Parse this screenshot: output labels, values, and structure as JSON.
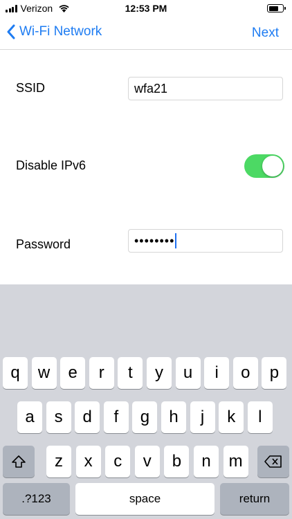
{
  "status_bar": {
    "carrier": "Verizon",
    "time": "12:53 PM",
    "battery_level": 0.7
  },
  "nav": {
    "back_label": "Wi-Fi Network",
    "next_label": "Next"
  },
  "form": {
    "ssid_label": "SSID",
    "ssid_value": "wfa21",
    "ipv6_label": "Disable IPv6",
    "ipv6_enabled": true,
    "password_label": "Password",
    "password_masked": "••••••••"
  },
  "keyboard": {
    "row1": [
      "q",
      "w",
      "e",
      "r",
      "t",
      "y",
      "u",
      "i",
      "o",
      "p"
    ],
    "row2": [
      "a",
      "s",
      "d",
      "f",
      "g",
      "h",
      "j",
      "k",
      "l"
    ],
    "row3": [
      "z",
      "x",
      "c",
      "v",
      "b",
      "n",
      "m"
    ],
    "numbers_label": ".?123",
    "space_label": "space",
    "return_label": "return"
  },
  "colors": {
    "accent": "#1e7cf2",
    "toggle_on": "#4cd964",
    "keyboard_bg": "#d3d5db"
  }
}
